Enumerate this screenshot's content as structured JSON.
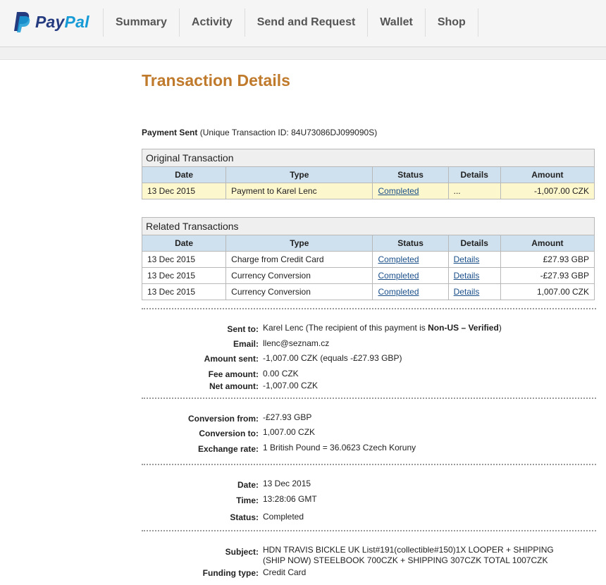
{
  "brand": {
    "name_pay": "Pay",
    "name_pal": "Pal",
    "color_dark": "#253b80",
    "color_light": "#179bd7"
  },
  "nav": [
    "Summary",
    "Activity",
    "Send and Request",
    "Wallet",
    "Shop"
  ],
  "page_title": "Transaction Details",
  "payment": {
    "label": "Payment Sent",
    "txid_text": "(Unique Transaction ID: 84U73086DJ099090S)"
  },
  "table_headers": [
    "Date",
    "Type",
    "Status",
    "Details",
    "Amount"
  ],
  "original": {
    "caption": "Original Transaction",
    "rows": [
      {
        "date": "13 Dec 2015",
        "type": "Payment to Karel Lenc",
        "status": "Completed",
        "details": "...",
        "amount": "-1,007.00 CZK"
      }
    ]
  },
  "related": {
    "caption": "Related Transactions",
    "rows": [
      {
        "date": "13 Dec 2015",
        "type": "Charge from Credit Card",
        "status": "Completed",
        "details": "Details",
        "amount": "£27.93 GBP"
      },
      {
        "date": "13 Dec 2015",
        "type": "Currency Conversion",
        "status": "Completed",
        "details": "Details",
        "amount": "-£27.93 GBP"
      },
      {
        "date": "13 Dec 2015",
        "type": "Currency Conversion",
        "status": "Completed",
        "details": "Details",
        "amount": "1,007.00 CZK"
      }
    ]
  },
  "details": {
    "sent_to_label": "Sent to:",
    "sent_to_name": "Karel Lenc (The recipient of this payment is ",
    "sent_to_status": "Non-US – Verified",
    "sent_to_close": ")",
    "email_label": "Email:",
    "email_value": "llenc@seznam.cz",
    "amount_label": "Amount sent:",
    "amount_value": "-1,007.00 CZK (equals -£27.93 GBP)",
    "fee_label": "Fee amount:",
    "fee_value": "0.00 CZK",
    "net_label": "Net amount:",
    "net_value": "-1,007.00 CZK"
  },
  "conversion": {
    "from_label": "Conversion from:",
    "from_value": "-£27.93 GBP",
    "to_label": "Conversion to:",
    "to_value": "1,007.00 CZK",
    "rate_label": "Exchange rate:",
    "rate_value": "1 British Pound = 36.0623 Czech Koruny"
  },
  "datetime": {
    "date_label": "Date:",
    "date_value": "13 Dec 2015",
    "time_label": "Time:",
    "time_value": "13:28:06 GMT",
    "status_label": "Status:",
    "status_value": "Completed"
  },
  "extra": {
    "subject_label": "Subject:",
    "subject_value": "HDN TRAVIS BICKLE UK List#191(collectible#150)1X LOOPER + SHIPPING (SHIP NOW) STEELBOOK 700CZK + SHIPPING 307CZK TOTAL 1007CZK",
    "funding_label": "Funding type:",
    "funding_value": "Credit Card"
  }
}
